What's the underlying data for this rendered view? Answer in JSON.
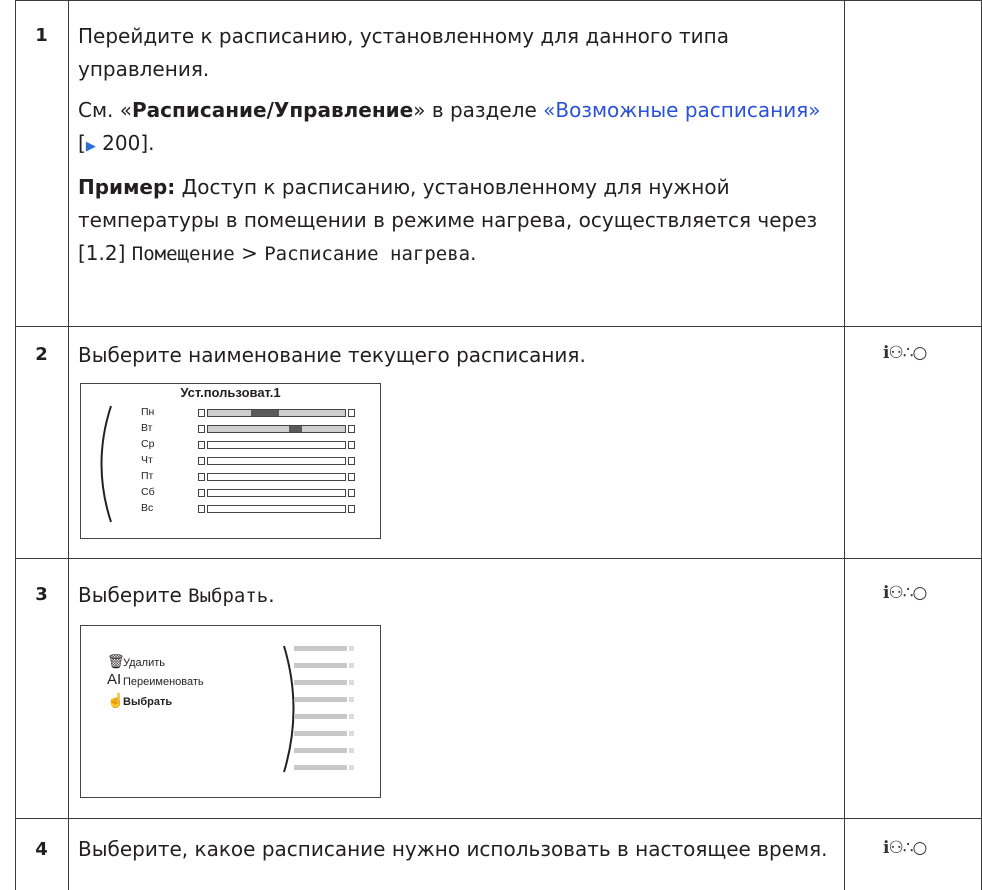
{
  "steps": [
    {
      "number": "1",
      "paragraph1": "Перейдите к расписанию, установленному для данного типа управления.",
      "ref_prefix": "См. «",
      "ref_bold": "Расписание/Управление",
      "ref_mid": "» в разделе ",
      "ref_link": "«Возможные расписания»",
      "ref_page_open": " [",
      "ref_arrow": "▶",
      "ref_page": " 200",
      "ref_page_close": "].",
      "example_label": "Пример:",
      "example_text": " Доступ к расписанию, установленному для нужной температуры в помещении в режиме нагрева, осуществляется через [1.2] ",
      "example_path_1": "Помещение",
      "example_sep": " > ",
      "example_path_2": "Расписание нагрева",
      "example_end": "."
    },
    {
      "number": "2",
      "text": "Выберите наименование текущего расписания.",
      "control": "ℹ⚇∴○",
      "screen": {
        "title": "Уст.пользоват.1",
        "days": [
          "Пн",
          "Вт",
          "Ср",
          "Чт",
          "Пт",
          "Сб",
          "Вс"
        ]
      }
    },
    {
      "number": "3",
      "text_prefix": "Выберите ",
      "text_item": "Выбрать",
      "text_end": ".",
      "control": "ℹ⚇∴○",
      "screen": {
        "menu": [
          {
            "icon": "🗑",
            "label": "Удалить"
          },
          {
            "icon": "AI",
            "label": "Переименовать"
          },
          {
            "icon": "☝",
            "label": "Выбрать"
          }
        ]
      }
    },
    {
      "number": "4",
      "text": "Выберите, какое расписание нужно использовать в настоящее время.",
      "control": "ℹ⚇∴○"
    }
  ]
}
